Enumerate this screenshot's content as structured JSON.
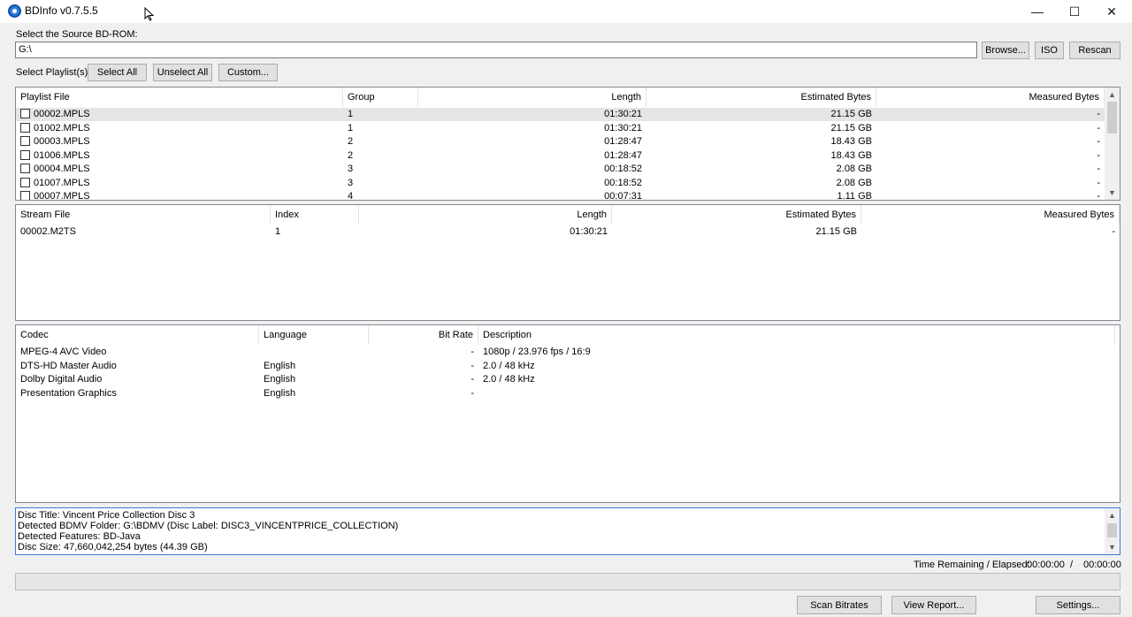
{
  "window": {
    "title": "BDInfo v0.7.5.5",
    "minimize_glyph": "—",
    "maximize_glyph": "☐",
    "close_glyph": "✕"
  },
  "source": {
    "label": "Select the Source BD-ROM:",
    "path": "G:\\",
    "browse_label": "Browse...",
    "iso_label": "ISO",
    "rescan_label": "Rescan"
  },
  "playlist_controls": {
    "label": "Select Playlist(s):",
    "select_all_label": "Select All",
    "unselect_all_label": "Unselect All",
    "custom_label": "Custom..."
  },
  "playlists": {
    "headers": [
      "Playlist File",
      "Group",
      "Length",
      "Estimated Bytes",
      "Measured Bytes"
    ],
    "rows": [
      {
        "file": "00002.MPLS",
        "group": "1",
        "length": "01:30:21",
        "est": "21.15 GB",
        "meas": "-"
      },
      {
        "file": "01002.MPLS",
        "group": "1",
        "length": "01:30:21",
        "est": "21.15 GB",
        "meas": "-"
      },
      {
        "file": "00003.MPLS",
        "group": "2",
        "length": "01:28:47",
        "est": "18.43 GB",
        "meas": "-"
      },
      {
        "file": "01006.MPLS",
        "group": "2",
        "length": "01:28:47",
        "est": "18.43 GB",
        "meas": "-"
      },
      {
        "file": "00004.MPLS",
        "group": "3",
        "length": "00:18:52",
        "est": "2.08 GB",
        "meas": "-"
      },
      {
        "file": "01007.MPLS",
        "group": "3",
        "length": "00:18:52",
        "est": "2.08 GB",
        "meas": "-"
      },
      {
        "file": "00007.MPLS",
        "group": "4",
        "length": "00:07:31",
        "est": "1.11 GB",
        "meas": "-"
      }
    ],
    "scroll_up": "▲",
    "scroll_down": "▼"
  },
  "streams": {
    "headers": [
      "Stream File",
      "Index",
      "Length",
      "Estimated Bytes",
      "Measured Bytes"
    ],
    "rows": [
      {
        "file": "00002.M2TS",
        "index": "1",
        "length": "01:30:21",
        "est": "21.15 GB",
        "meas": "-"
      }
    ]
  },
  "codecs": {
    "headers": [
      "Codec",
      "Language",
      "Bit Rate",
      "Description"
    ],
    "rows": [
      {
        "codec": "MPEG-4 AVC Video",
        "language": "",
        "bitrate": "-",
        "description": "1080p / 23.976 fps / 16:9"
      },
      {
        "codec": "DTS-HD Master Audio",
        "language": "English",
        "bitrate": "-",
        "description": "2.0 / 48 kHz"
      },
      {
        "codec": "Dolby Digital Audio",
        "language": "English",
        "bitrate": "-",
        "description": "2.0 / 48 kHz"
      },
      {
        "codec": "Presentation Graphics",
        "language": "English",
        "bitrate": "-",
        "description": ""
      }
    ]
  },
  "disc_info": [
    "Disc Title: Vincent Price Collection Disc 3",
    "Detected BDMV Folder: G:\\BDMV (Disc Label: DISC3_VINCENTPRICE_COLLECTION)",
    "Detected Features: BD-Java",
    "Disc Size: 47,660,042,254 bytes (44.39 GB)"
  ],
  "status": {
    "time_label": "Time Remaining / Elapsed:",
    "remaining": "00:00:00",
    "separator": "/",
    "elapsed": "00:00:00",
    "progress": 0
  },
  "bottom_buttons": {
    "scan_label": "Scan Bitrates",
    "report_label": "View Report...",
    "settings_label": "Settings..."
  }
}
